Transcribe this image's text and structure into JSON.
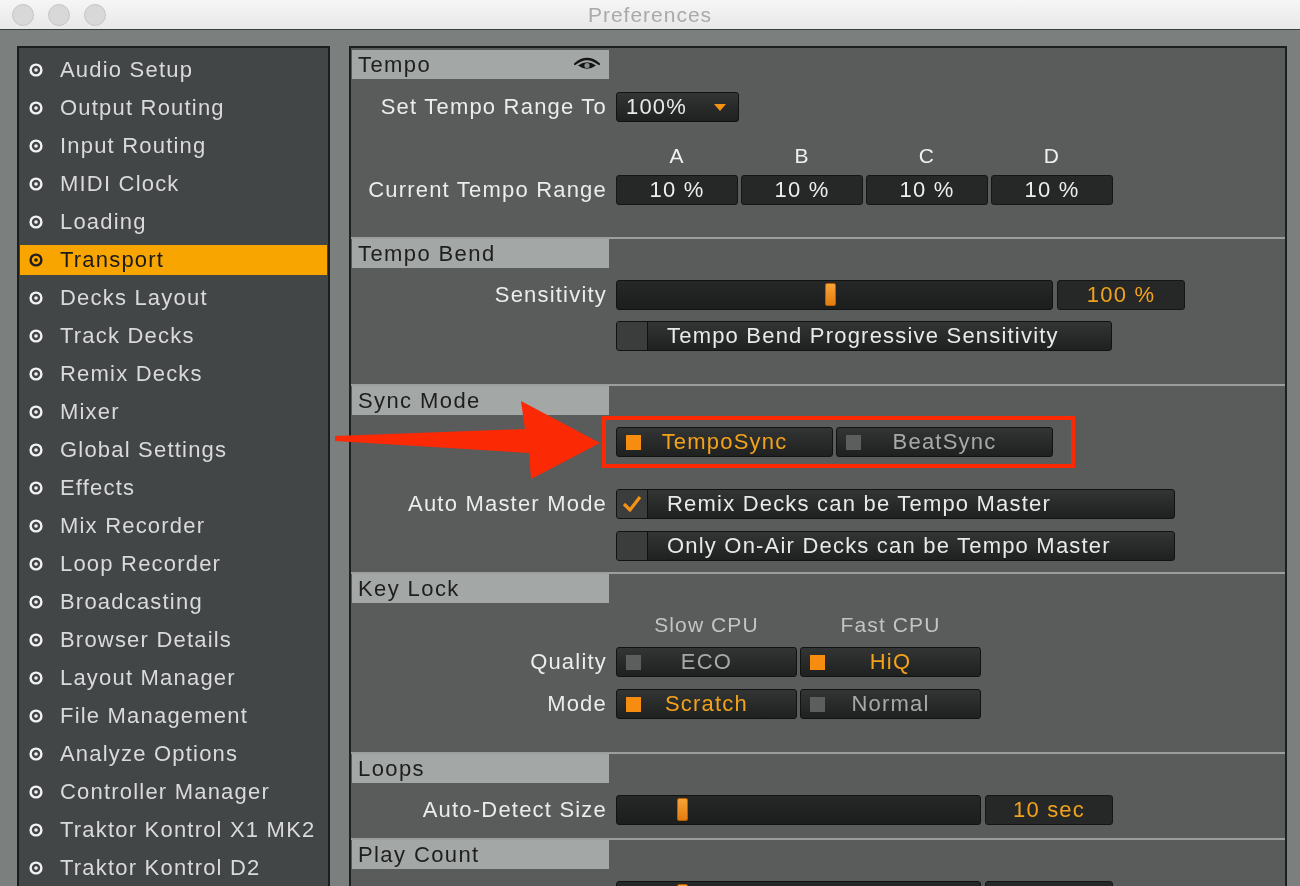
{
  "window": {
    "title": "Preferences"
  },
  "sidebar": {
    "items": [
      {
        "label": "Audio Setup",
        "selected": false
      },
      {
        "label": "Output Routing",
        "selected": false
      },
      {
        "label": "Input Routing",
        "selected": false
      },
      {
        "label": "MIDI Clock",
        "selected": false
      },
      {
        "label": "Loading",
        "selected": false
      },
      {
        "label": "Transport",
        "selected": true
      },
      {
        "label": "Decks Layout",
        "selected": false
      },
      {
        "label": "Track Decks",
        "selected": false
      },
      {
        "label": "Remix Decks",
        "selected": false
      },
      {
        "label": "Mixer",
        "selected": false
      },
      {
        "label": "Global Settings",
        "selected": false
      },
      {
        "label": "Effects",
        "selected": false
      },
      {
        "label": "Mix Recorder",
        "selected": false
      },
      {
        "label": "Loop Recorder",
        "selected": false
      },
      {
        "label": "Broadcasting",
        "selected": false
      },
      {
        "label": "Browser Details",
        "selected": false
      },
      {
        "label": "Layout Manager",
        "selected": false
      },
      {
        "label": "File Management",
        "selected": false
      },
      {
        "label": "Analyze Options",
        "selected": false
      },
      {
        "label": "Controller Manager",
        "selected": false
      },
      {
        "label": "Traktor Kontrol X1 MK2",
        "selected": false
      },
      {
        "label": "Traktor Kontrol D2",
        "selected": false
      }
    ]
  },
  "sections": [
    {
      "title": "Tempo",
      "visibility_toggle": true,
      "rows": [
        {
          "kind": "dropdown",
          "label": "Set Tempo Range To",
          "value": "100%"
        },
        {
          "kind": "column_heads",
          "heads": [
            "A",
            "B",
            "C",
            "D"
          ]
        },
        {
          "kind": "readouts",
          "label": "Current Tempo Range",
          "values": [
            "10 %",
            "10 %",
            "10 %",
            "10 %"
          ]
        }
      ]
    },
    {
      "title": "Tempo Bend",
      "rows": [
        {
          "kind": "slider",
          "label": "Sensitivity",
          "level": 0.49,
          "reading": "100 %"
        },
        {
          "kind": "checkbox",
          "text": "Tempo Bend Progressive Sensitivity",
          "checked": false
        }
      ]
    },
    {
      "title": "Sync Mode",
      "rows": [
        {
          "kind": "radio_group",
          "highlighted": true,
          "options": [
            {
              "label": "TempoSync",
              "selected": true
            },
            {
              "label": "BeatSync",
              "selected": false
            }
          ]
        },
        {
          "kind": "checkbox",
          "label": "Auto Master Mode",
          "text": "Remix Decks can be Tempo Master",
          "checked": true
        },
        {
          "kind": "checkbox",
          "text": "Only On-Air Decks can be Tempo Master",
          "checked": false
        }
      ]
    },
    {
      "title": "Key Lock",
      "rows": [
        {
          "kind": "column_heads",
          "heads": [
            "Slow CPU",
            "Fast CPU"
          ]
        },
        {
          "kind": "radio_group",
          "label": "Quality",
          "options": [
            {
              "label": "ECO",
              "selected": false
            },
            {
              "label": "HiQ",
              "selected": true
            }
          ]
        },
        {
          "kind": "radio_group",
          "label": "Mode",
          "options": [
            {
              "label": "Scratch",
              "selected": true
            },
            {
              "label": "Normal",
              "selected": false
            }
          ]
        }
      ]
    },
    {
      "title": "Loops",
      "rows": [
        {
          "kind": "slider",
          "label": "Auto-Detect Size",
          "level": 0.18,
          "reading": "10 sec"
        }
      ]
    },
    {
      "title": "Play Count",
      "rows": [
        {
          "kind": "slider",
          "level": 0.18
        }
      ]
    }
  ]
}
